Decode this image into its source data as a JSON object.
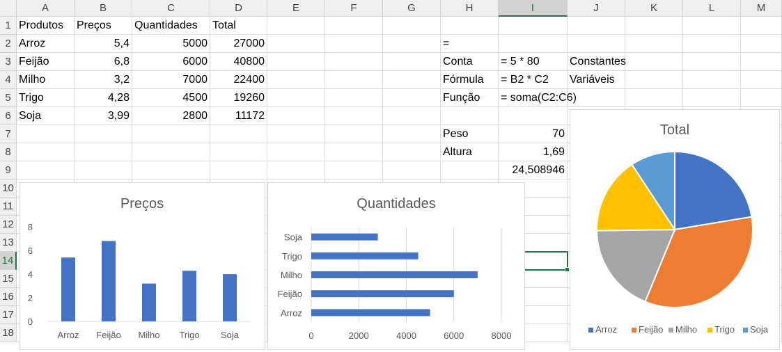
{
  "sheet": {
    "columns": [
      "A",
      "B",
      "C",
      "D",
      "E",
      "F",
      "G",
      "H",
      "I",
      "J",
      "K",
      "L",
      "M"
    ],
    "rows": [
      "1",
      "2",
      "3",
      "4",
      "5",
      "6",
      "7",
      "8",
      "9",
      "10",
      "11",
      "12",
      "13",
      "14",
      "15",
      "16",
      "17",
      "18"
    ],
    "selected_column": "I",
    "selected_row": "14",
    "cells": [
      {
        "ref": "A1",
        "text": "Produtos"
      },
      {
        "ref": "B1",
        "text": "Preços"
      },
      {
        "ref": "C1",
        "text": "Quantidades"
      },
      {
        "ref": "D1",
        "text": "Total"
      },
      {
        "ref": "A2",
        "text": "Arroz"
      },
      {
        "ref": "B2",
        "text": "5,4",
        "align": "right"
      },
      {
        "ref": "C2",
        "text": "5000",
        "align": "right"
      },
      {
        "ref": "D2",
        "text": "27000",
        "align": "right"
      },
      {
        "ref": "A3",
        "text": "Feijão"
      },
      {
        "ref": "B3",
        "text": "6,8",
        "align": "right"
      },
      {
        "ref": "C3",
        "text": "6000",
        "align": "right"
      },
      {
        "ref": "D3",
        "text": "40800",
        "align": "right"
      },
      {
        "ref": "A4",
        "text": "Milho"
      },
      {
        "ref": "B4",
        "text": "3,2",
        "align": "right"
      },
      {
        "ref": "C4",
        "text": "7000",
        "align": "right"
      },
      {
        "ref": "D4",
        "text": "22400",
        "align": "right"
      },
      {
        "ref": "A5",
        "text": "Trigo"
      },
      {
        "ref": "B5",
        "text": "4,28",
        "align": "right"
      },
      {
        "ref": "C5",
        "text": "4500",
        "align": "right"
      },
      {
        "ref": "D5",
        "text": "19260",
        "align": "right"
      },
      {
        "ref": "A6",
        "text": "Soja"
      },
      {
        "ref": "B6",
        "text": "3,99",
        "align": "right"
      },
      {
        "ref": "C6",
        "text": "2800",
        "align": "right"
      },
      {
        "ref": "D6",
        "text": "11172",
        "align": "right"
      },
      {
        "ref": "H2",
        "text": "="
      },
      {
        "ref": "H3",
        "text": "Conta"
      },
      {
        "ref": "I3",
        "text": "= 5 * 80"
      },
      {
        "ref": "J3",
        "text": "Constantes"
      },
      {
        "ref": "H4",
        "text": "Fórmula"
      },
      {
        "ref": "I4",
        "text": "= B2 * C2"
      },
      {
        "ref": "J4",
        "text": "Variáveis"
      },
      {
        "ref": "H5",
        "text": "Função"
      },
      {
        "ref": "I5",
        "text": "= soma(C2:C6)"
      },
      {
        "ref": "H7",
        "text": "Peso"
      },
      {
        "ref": "I7",
        "text": "70",
        "align": "right"
      },
      {
        "ref": "H8",
        "text": "Altura"
      },
      {
        "ref": "I8",
        "text": "1,69",
        "align": "right"
      },
      {
        "ref": "I9",
        "text": "24,508946",
        "align": "right"
      }
    ]
  },
  "chart_data": [
    {
      "type": "bar",
      "title": "Preços",
      "categories": [
        "Arroz",
        "Feijão",
        "Milho",
        "Trigo",
        "Soja"
      ],
      "values": [
        5.4,
        6.8,
        3.2,
        4.28,
        3.99
      ],
      "ylim": [
        0,
        8
      ],
      "yticks": [
        "0",
        "2",
        "4",
        "6",
        "8"
      ],
      "color": "#4472c4",
      "grid": false
    },
    {
      "type": "bar",
      "orientation": "horizontal",
      "title": "Quantidades",
      "categories": [
        "Arroz",
        "Feijão",
        "Milho",
        "Trigo",
        "Soja"
      ],
      "values": [
        5000,
        6000,
        7000,
        4500,
        2800
      ],
      "xlim": [
        0,
        8000
      ],
      "xticks": [
        "0",
        "2000",
        "4000",
        "6000",
        "8000"
      ],
      "color": "#4472c4",
      "grid": true
    },
    {
      "type": "pie",
      "title": "Total",
      "categories": [
        "Arroz",
        "Feijão",
        "Milho",
        "Trigo",
        "Soja"
      ],
      "values": [
        27000,
        40800,
        22400,
        19260,
        11172
      ],
      "colors": [
        "#4472c4",
        "#ed7d31",
        "#a5a5a5",
        "#ffc000",
        "#5b9bd5"
      ],
      "legend": "bottom"
    }
  ]
}
